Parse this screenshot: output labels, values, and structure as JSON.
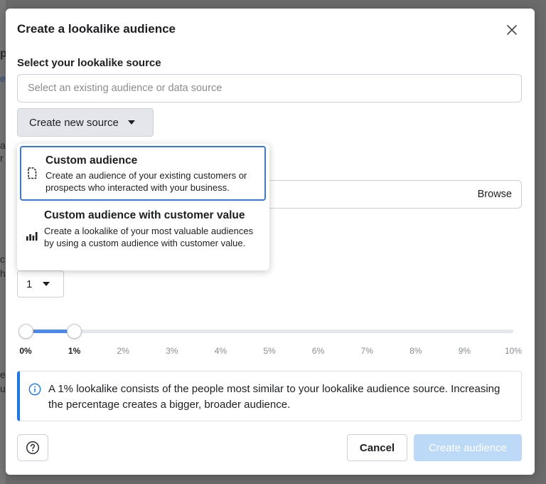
{
  "modal": {
    "title": "Create a lookalike audience",
    "source_label": "Select your lookalike source",
    "source_placeholder": "Select an existing audience or data source",
    "create_source_label": "Create new source",
    "browse_label": "Browse",
    "count_value": "1"
  },
  "dropdown": {
    "items": [
      {
        "title": "Custom audience",
        "description": "Create an audience of your existing customers or prospects who interacted with your business.",
        "icon": "document-icon",
        "selected": true
      },
      {
        "title": "Custom audience with customer value",
        "description": "Create a lookalike of your most valuable audiences by using a custom audience with customer value.",
        "icon": "bar-chart-icon",
        "selected": false
      }
    ]
  },
  "slider": {
    "ticks": [
      "0%",
      "1%",
      "2%",
      "3%",
      "4%",
      "5%",
      "6%",
      "7%",
      "8%",
      "9%",
      "10%"
    ],
    "range_start_percent": 0,
    "range_end_percent": 1,
    "accent_color": "#4a89f0"
  },
  "info": {
    "text": "A 1% lookalike consists of the people most similar to your lookalike audience source. Increasing the percentage creates a bigger, broader audience.",
    "accent_color": "#1877f2"
  },
  "footer": {
    "cancel_label": "Cancel",
    "create_label": "Create audience"
  }
}
